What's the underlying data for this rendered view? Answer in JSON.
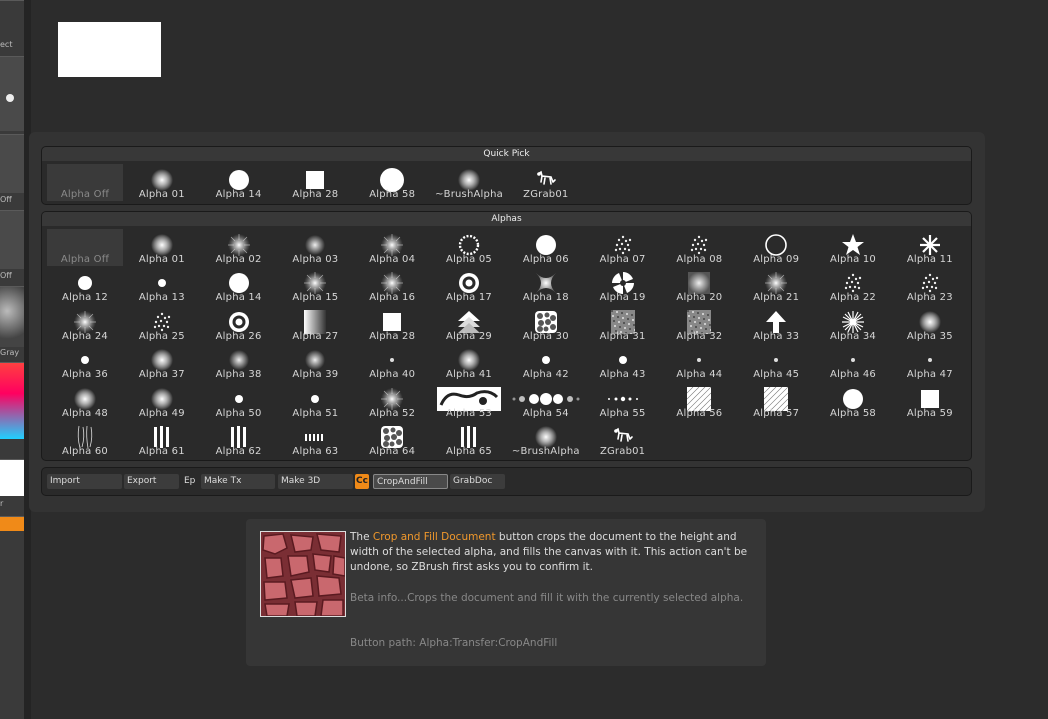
{
  "left_strip": {
    "labels": [
      "ect",
      "Off",
      "Off",
      "Gray",
      "r"
    ]
  },
  "quick_pick": {
    "title": "Quick Pick",
    "items": [
      {
        "label": "Alpha Off",
        "icon": "empty",
        "off": true
      },
      {
        "label": "Alpha 01",
        "icon": "soft-dot"
      },
      {
        "label": "Alpha 14",
        "icon": "hard-circle"
      },
      {
        "label": "Alpha 28",
        "icon": "square"
      },
      {
        "label": "Alpha 58",
        "icon": "hard-circle-large"
      },
      {
        "label": "~BrushAlpha",
        "icon": "soft-dot"
      },
      {
        "label": "ZGrab01",
        "icon": "dog"
      }
    ]
  },
  "alphas": {
    "title": "Alphas",
    "items": [
      {
        "label": "Alpha Off",
        "icon": "empty",
        "off": true
      },
      {
        "label": "Alpha 01",
        "icon": "soft-dot"
      },
      {
        "label": "Alpha 02",
        "icon": "fuzzy"
      },
      {
        "label": "Alpha 03",
        "icon": "soft-dot-dim"
      },
      {
        "label": "Alpha 04",
        "icon": "fuzzy"
      },
      {
        "label": "Alpha 05",
        "icon": "ring-dotted"
      },
      {
        "label": "Alpha 06",
        "icon": "hard-circle"
      },
      {
        "label": "Alpha 07",
        "icon": "speckle"
      },
      {
        "label": "Alpha 08",
        "icon": "speckle"
      },
      {
        "label": "Alpha 09",
        "icon": "ring"
      },
      {
        "label": "Alpha 10",
        "icon": "star"
      },
      {
        "label": "Alpha 11",
        "icon": "asterisk"
      },
      {
        "label": "Alpha 12",
        "icon": "hard-circle-small"
      },
      {
        "label": "Alpha 13",
        "icon": "dot-small"
      },
      {
        "label": "Alpha 14",
        "icon": "hard-circle"
      },
      {
        "label": "Alpha 15",
        "icon": "fuzzy"
      },
      {
        "label": "Alpha 16",
        "icon": "fuzzy"
      },
      {
        "label": "Alpha 17",
        "icon": "target"
      },
      {
        "label": "Alpha 18",
        "icon": "diamond-soft"
      },
      {
        "label": "Alpha 19",
        "icon": "swirl"
      },
      {
        "label": "Alpha 20",
        "icon": "soft-square"
      },
      {
        "label": "Alpha 21",
        "icon": "fuzzy"
      },
      {
        "label": "Alpha 22",
        "icon": "speckle"
      },
      {
        "label": "Alpha 23",
        "icon": "speckle"
      },
      {
        "label": "Alpha 24",
        "icon": "fuzzy"
      },
      {
        "label": "Alpha 25",
        "icon": "speckle"
      },
      {
        "label": "Alpha 26",
        "icon": "target"
      },
      {
        "label": "Alpha 27",
        "icon": "gradient-square"
      },
      {
        "label": "Alpha 28",
        "icon": "square"
      },
      {
        "label": "Alpha 29",
        "icon": "layered-arrow"
      },
      {
        "label": "Alpha 30",
        "icon": "cells"
      },
      {
        "label": "Alpha 31",
        "icon": "noise-square"
      },
      {
        "label": "Alpha 32",
        "icon": "noise-square"
      },
      {
        "label": "Alpha 33",
        "icon": "arrow-up"
      },
      {
        "label": "Alpha 34",
        "icon": "burst"
      },
      {
        "label": "Alpha 35",
        "icon": "soft-dot"
      },
      {
        "label": "Alpha 36",
        "icon": "dot-small"
      },
      {
        "label": "Alpha 37",
        "icon": "soft-dot"
      },
      {
        "label": "Alpha 38",
        "icon": "soft-dot-dim"
      },
      {
        "label": "Alpha 39",
        "icon": "soft-dot-dim"
      },
      {
        "label": "Alpha 40",
        "icon": "dot-tiny"
      },
      {
        "label": "Alpha 41",
        "icon": "soft-dot"
      },
      {
        "label": "Alpha 42",
        "icon": "dot-small"
      },
      {
        "label": "Alpha 43",
        "icon": "dot-small"
      },
      {
        "label": "Alpha 44",
        "icon": "dot-tiny"
      },
      {
        "label": "Alpha 45",
        "icon": "dot-tiny"
      },
      {
        "label": "Alpha 46",
        "icon": "dot-tiny"
      },
      {
        "label": "Alpha 47",
        "icon": "dot-tiny"
      },
      {
        "label": "Alpha 48",
        "icon": "soft-dot"
      },
      {
        "label": "Alpha 49",
        "icon": "soft-dot"
      },
      {
        "label": "Alpha 50",
        "icon": "dot-small"
      },
      {
        "label": "Alpha 51",
        "icon": "dot-small"
      },
      {
        "label": "Alpha 52",
        "icon": "fuzzy"
      },
      {
        "label": "Alpha 53",
        "icon": "ornament"
      },
      {
        "label": "Alpha 54",
        "icon": "dot-row"
      },
      {
        "label": "Alpha 55",
        "icon": "dot-row-small"
      },
      {
        "label": "Alpha 56",
        "icon": "hatch-square"
      },
      {
        "label": "Alpha 57",
        "icon": "hatch-square"
      },
      {
        "label": "Alpha 58",
        "icon": "hard-circle"
      },
      {
        "label": "Alpha 59",
        "icon": "square"
      },
      {
        "label": "Alpha 60",
        "icon": "streaks"
      },
      {
        "label": "Alpha 61",
        "icon": "bars"
      },
      {
        "label": "Alpha 62",
        "icon": "bars"
      },
      {
        "label": "Alpha 63",
        "icon": "bars-short"
      },
      {
        "label": "Alpha 64",
        "icon": "cells"
      },
      {
        "label": "Alpha 65",
        "icon": "bars"
      },
      {
        "label": "~BrushAlpha",
        "icon": "soft-dot"
      },
      {
        "label": "ZGrab01",
        "icon": "dog"
      }
    ]
  },
  "toolbar": {
    "import": "Import",
    "export": "Export",
    "ep": "Ep",
    "make_tx": "Make Tx",
    "make_3d": "Make 3D",
    "cc": "Cc",
    "crop_and_fill": "CropAndFill",
    "grab_doc": "GrabDoc"
  },
  "info": {
    "the": "The",
    "highlight": "Crop and Fill Document",
    "desc": "button crops the document to the height and width of the selected alpha, and fills the canvas with it. This action can't be undone, so ZBrush first asks you to confirm it.",
    "beta": "Beta info...Crops the document and fill it with the currently selected alpha.",
    "path": "Button path: Alpha:Transfer:CropAndFill"
  },
  "colors": {
    "accent": "#f08a18",
    "highlight_text": "#f0982c",
    "panel_bg": "#2a2a2a",
    "page_bg": "#2c2c2c"
  }
}
